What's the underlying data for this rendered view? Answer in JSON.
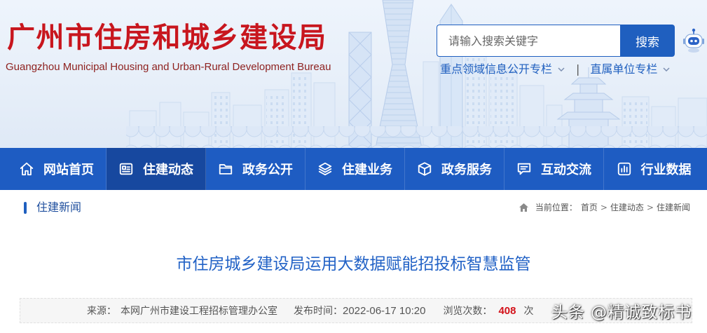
{
  "header": {
    "title": "广州市住房和城乡建设局",
    "subtitle": "Guangzhou Municipal Housing and Urban-Rural Development Bureau",
    "search": {
      "placeholder": "请输入搜索关键字",
      "button_label": "搜索"
    },
    "assistant_icon": "robot-icon",
    "links": [
      {
        "label": "重点领域信息公开专栏",
        "icon": "chevron-down-icon"
      },
      {
        "label": "直属单位专栏",
        "icon": "chevron-down-icon"
      }
    ],
    "link_separator": "|"
  },
  "nav": {
    "items": [
      {
        "label": "网站首页",
        "icon": "home-icon"
      },
      {
        "label": "住建动态",
        "icon": "news-icon",
        "active": true
      },
      {
        "label": "政务公开",
        "icon": "folder-icon"
      },
      {
        "label": "住建业务",
        "icon": "layers-icon"
      },
      {
        "label": "政务服务",
        "icon": "cube-icon"
      },
      {
        "label": "互动交流",
        "icon": "chat-icon"
      },
      {
        "label": "行业数据",
        "icon": "bar-chart-icon"
      }
    ]
  },
  "section": {
    "title": "住建新闻"
  },
  "breadcrumb": {
    "icon": "home-icon",
    "prefix": "当前位置：",
    "items": [
      "首页",
      "住建动态",
      "住建新闻"
    ],
    "separator": ">"
  },
  "article": {
    "title": "市住房城乡建设局运用大数据赋能招投标智慧监管",
    "meta": {
      "source_label": "来源：",
      "source": "本网广州市建设工程招标管理办公室",
      "date_label": "发布时间：",
      "date": "2022-06-17 10:20",
      "views_label": "浏览次数：",
      "views": "408",
      "views_unit": "次"
    }
  },
  "watermark": {
    "text": "头条 @精诚致标书"
  },
  "colors": {
    "brand_red": "#c8161e",
    "subtitle_red": "#8e2220",
    "link_blue": "#1f5fbf",
    "nav_blue": "#1e5cc2",
    "nav_active": "#17489f",
    "title_blue": "#2262c6",
    "views_red": "#d3121a"
  }
}
